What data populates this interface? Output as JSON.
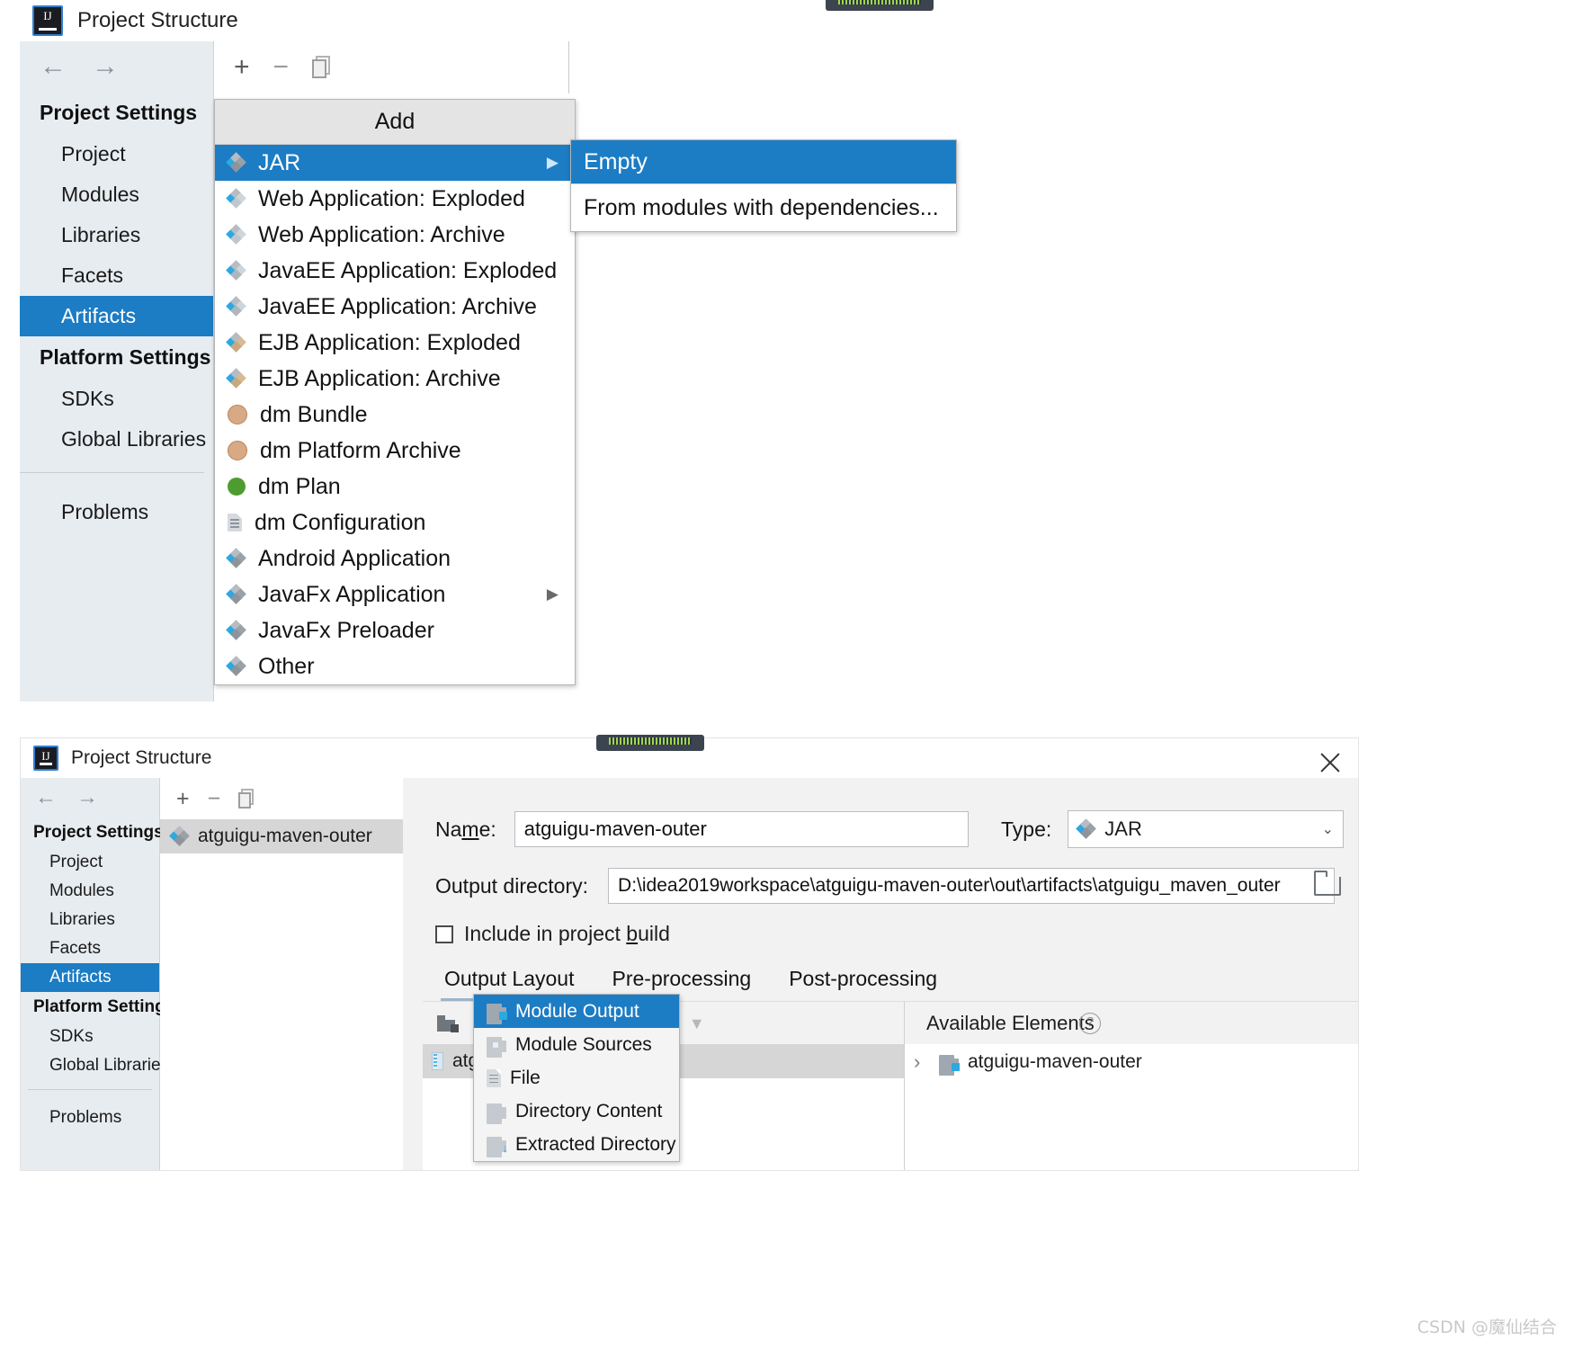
{
  "app": {
    "title": "Project Structure",
    "logo_text": "IJ"
  },
  "watermark": "CSDN @魔仙结合",
  "top_window": {
    "nav": {
      "back": "←",
      "forward": "→"
    },
    "sidebar": {
      "group_project": "Project Settings",
      "group_platform": "Platform Settings",
      "items_project": [
        "Project",
        "Modules",
        "Libraries",
        "Facets",
        "Artifacts"
      ],
      "selected_project_item": "Artifacts",
      "items_platform": [
        "SDKs",
        "Global Libraries"
      ],
      "problems": "Problems"
    },
    "toolbar": {
      "add": "+",
      "remove": "−",
      "copy": "copy-icon"
    },
    "add_menu": {
      "title": "Add",
      "items": [
        {
          "label": "JAR",
          "icon": "jar-diamond-icon",
          "selected": true,
          "submenu": true
        },
        {
          "label": "Web Application: Exploded",
          "icon": "web-exploded-icon",
          "selected": false,
          "submenu": false
        },
        {
          "label": "Web Application: Archive",
          "icon": "web-archive-icon",
          "selected": false,
          "submenu": false
        },
        {
          "label": "JavaEE Application: Exploded",
          "icon": "javaee-exploded-icon",
          "selected": false,
          "submenu": false
        },
        {
          "label": "JavaEE Application: Archive",
          "icon": "javaee-archive-icon",
          "selected": false,
          "submenu": false
        },
        {
          "label": "EJB Application: Exploded",
          "icon": "ejb-exploded-icon",
          "selected": false,
          "submenu": false
        },
        {
          "label": "EJB Application: Archive",
          "icon": "ejb-archive-icon",
          "selected": false,
          "submenu": false
        },
        {
          "label": "dm Bundle",
          "icon": "dm-bundle-icon",
          "selected": false,
          "submenu": false
        },
        {
          "label": "dm Platform Archive",
          "icon": "dm-platform-icon",
          "selected": false,
          "submenu": false
        },
        {
          "label": "dm Plan",
          "icon": "dm-plan-icon",
          "selected": false,
          "submenu": false
        },
        {
          "label": "dm Configuration",
          "icon": "dm-config-icon",
          "selected": false,
          "submenu": false
        },
        {
          "label": "Android Application",
          "icon": "android-icon",
          "selected": false,
          "submenu": false
        },
        {
          "label": "JavaFx Application",
          "icon": "javafx-icon",
          "selected": false,
          "submenu": true
        },
        {
          "label": "JavaFx Preloader",
          "icon": "javafx-preloader-icon",
          "selected": false,
          "submenu": false
        },
        {
          "label": "Other",
          "icon": "other-icon",
          "selected": false,
          "submenu": false
        }
      ]
    },
    "jar_submenu": {
      "items": [
        {
          "label": "Empty",
          "selected": true
        },
        {
          "label": "From modules with dependencies...",
          "selected": false
        }
      ]
    }
  },
  "bottom_window": {
    "close": "×",
    "sidebar": {
      "group_project": "Project Settings",
      "group_platform": "Platform Settings",
      "items_project": [
        "Project",
        "Modules",
        "Libraries",
        "Facets",
        "Artifacts"
      ],
      "selected_project_item": "Artifacts",
      "items_platform": [
        "SDKs",
        "Global Libraries"
      ],
      "problems": "Problems"
    },
    "toolbar": {
      "add": "+",
      "remove": "−",
      "copy": "copy-icon"
    },
    "artifact_list": [
      {
        "label": "atguigu-maven-outer",
        "selected": true
      }
    ],
    "form": {
      "name_label": "Name:",
      "name_label_pre": "Na",
      "name_label_underlined": "m",
      "name_label_post": "e:",
      "name_value": "atguigu-maven-outer",
      "type_label": "Type:",
      "type_value": "JAR",
      "output_dir_label": "Output directory:",
      "output_dir_value": "D:\\idea2019workspace\\atguigu-maven-outer\\out\\artifacts\\atguigu_maven_outer",
      "include_label_pre": "Include in project ",
      "include_label_underlined": "b",
      "include_label_post": "uild",
      "include_checked": false
    },
    "tabs": [
      {
        "label": "Output Layout",
        "active": true
      },
      {
        "label": "Pre-processing",
        "active": false
      },
      {
        "label": "Post-processing",
        "active": false
      }
    ],
    "layout_toolbar": {
      "create_dir": "create-directory-icon",
      "create_archive": "create-archive-icon",
      "add": "+",
      "remove": "−",
      "sort": "sort-az-icon",
      "move_up": "▲",
      "move_down": "▼"
    },
    "output_tree": [
      {
        "label": "atguig",
        "icon": "jar-icon"
      }
    ],
    "add_element_menu": {
      "items": [
        {
          "label": "Module Output",
          "icon": "module-output-icon",
          "selected": true
        },
        {
          "label": "Module Sources",
          "icon": "module-sources-icon",
          "selected": false
        },
        {
          "label": "File",
          "icon": "file-icon",
          "selected": false
        },
        {
          "label": "Directory Content",
          "icon": "directory-content-icon",
          "selected": false
        },
        {
          "label": "Extracted Directory",
          "icon": "extracted-directory-icon",
          "selected": false
        }
      ]
    },
    "available_elements": {
      "title": "Available Elements",
      "help": "?",
      "items": [
        {
          "label": "atguigu-maven-outer",
          "expander": "›",
          "icon": "module-output-icon"
        }
      ]
    }
  }
}
